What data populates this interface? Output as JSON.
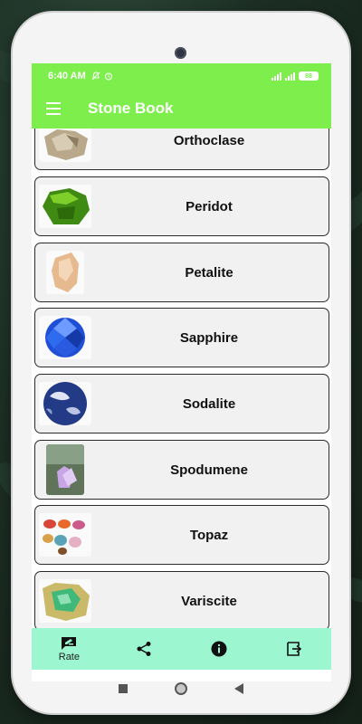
{
  "status_bar": {
    "time": "6:40 AM",
    "battery": "88"
  },
  "app_bar": {
    "title": "Stone Book"
  },
  "stones": [
    {
      "name": "Orthoclase"
    },
    {
      "name": "Peridot"
    },
    {
      "name": "Petalite"
    },
    {
      "name": "Sapphire"
    },
    {
      "name": "Sodalite"
    },
    {
      "name": "Spodumene"
    },
    {
      "name": "Topaz"
    },
    {
      "name": "Variscite"
    }
  ],
  "bottom_nav": {
    "rate_label": "Rate",
    "items": [
      "rate",
      "share",
      "info",
      "exit"
    ]
  },
  "colors": {
    "primary": "#7dee4b",
    "bottom_nav": "#9cf6cf",
    "card_background": "#f1f1f1"
  }
}
